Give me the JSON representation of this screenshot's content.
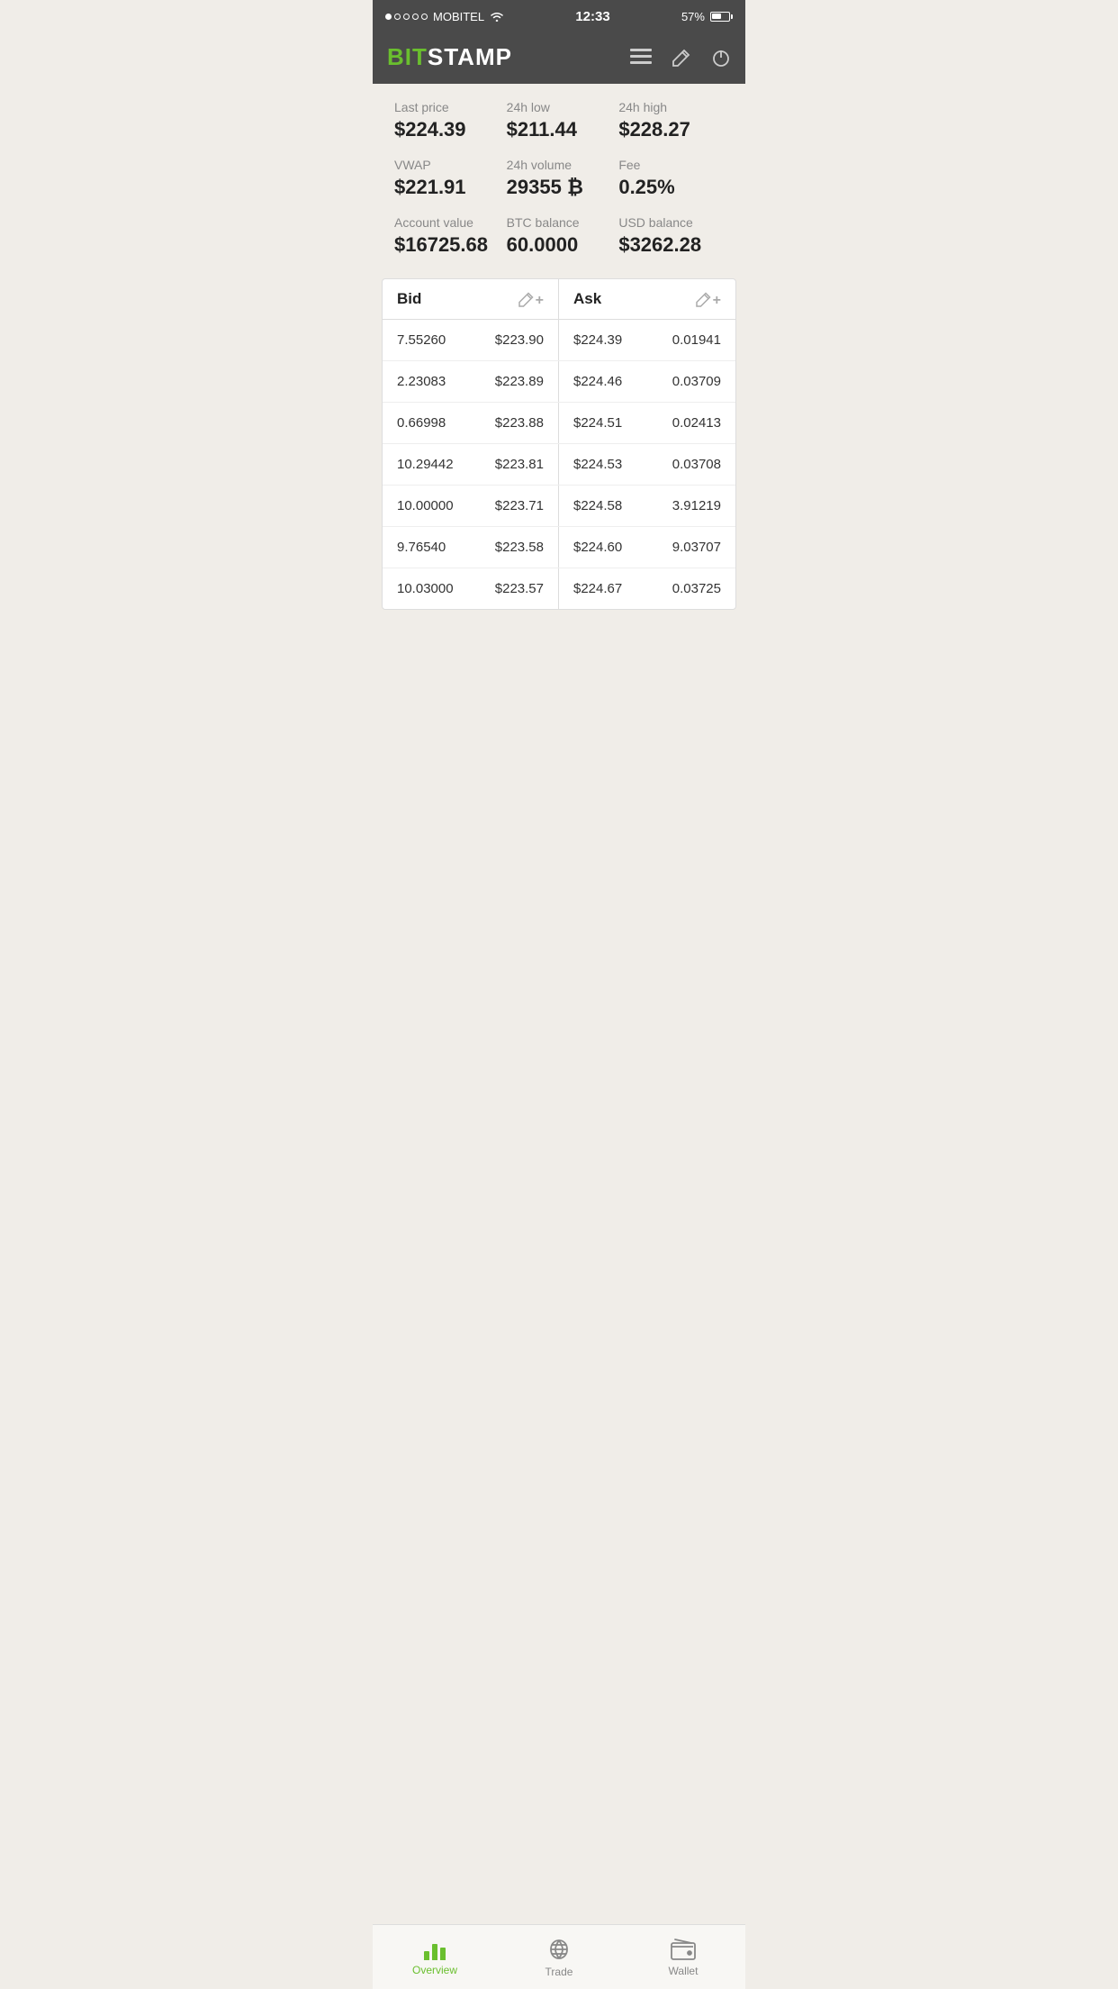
{
  "statusBar": {
    "carrier": "MOBITEL",
    "time": "12:33",
    "battery": "57%"
  },
  "header": {
    "logoBit": "BIT",
    "logoStamp": "STAMP",
    "menuIcon": "≡",
    "editIcon": "✏",
    "powerIcon": "⏻"
  },
  "stats": [
    {
      "label": "Last price",
      "value": "$224.39"
    },
    {
      "label": "24h low",
      "value": "$211.44"
    },
    {
      "label": "24h high",
      "value": "$228.27"
    },
    {
      "label": "VWAP",
      "value": "$221.91"
    },
    {
      "label": "24h volume",
      "value": "29355 ₿"
    },
    {
      "label": "Fee",
      "value": "0.25%"
    },
    {
      "label": "Account value",
      "value": "$16725.68"
    },
    {
      "label": "BTC balance",
      "value": "60.0000"
    },
    {
      "label": "USD balance",
      "value": "$3262.28"
    }
  ],
  "orderBook": {
    "bidHeader": "Bid",
    "askHeader": "Ask",
    "rows": [
      {
        "bidQty": "7.55260",
        "bidPrice": "$223.90",
        "askPrice": "$224.39",
        "askQty": "0.01941"
      },
      {
        "bidQty": "2.23083",
        "bidPrice": "$223.89",
        "askPrice": "$224.46",
        "askQty": "0.03709"
      },
      {
        "bidQty": "0.66998",
        "bidPrice": "$223.88",
        "askPrice": "$224.51",
        "askQty": "0.02413"
      },
      {
        "bidQty": "10.29442",
        "bidPrice": "$223.81",
        "askPrice": "$224.53",
        "askQty": "0.03708"
      },
      {
        "bidQty": "10.00000",
        "bidPrice": "$223.71",
        "askPrice": "$224.58",
        "askQty": "3.91219"
      },
      {
        "bidQty": "9.76540",
        "bidPrice": "$223.58",
        "askPrice": "$224.60",
        "askQty": "9.03707"
      },
      {
        "bidQty": "10.03000",
        "bidPrice": "$223.57",
        "askPrice": "$224.67",
        "askQty": "0.03725"
      }
    ]
  },
  "bottomNav": {
    "items": [
      {
        "label": "Overview",
        "active": true
      },
      {
        "label": "Trade",
        "active": false
      },
      {
        "label": "Wallet",
        "active": false
      }
    ]
  }
}
